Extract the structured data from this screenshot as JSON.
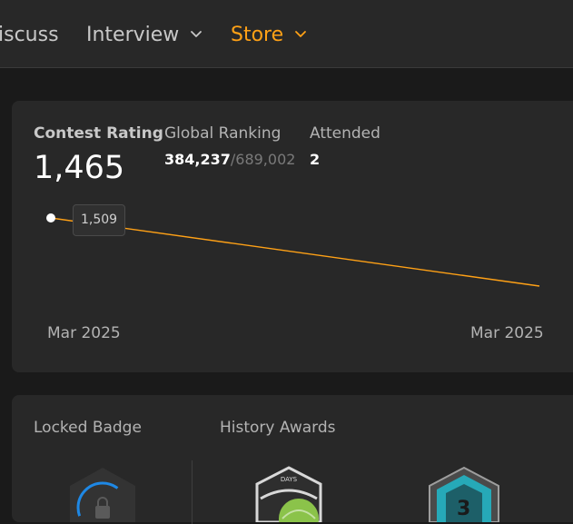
{
  "nav": {
    "items": [
      {
        "label": "iscuss"
      },
      {
        "label": "Interview"
      },
      {
        "label": "Store"
      }
    ],
    "accent": "#ffa116"
  },
  "rating": {
    "contest_rating_label": "Contest Rating",
    "contest_rating_value": "1,465",
    "global_ranking_label": "Global Ranking",
    "global_ranking_value": "384,237",
    "global_ranking_total": "/689,002",
    "attended_label": "Attended",
    "attended_value": "2",
    "tooltip_value": "1,509"
  },
  "chart_data": {
    "type": "line",
    "x": [
      "Mar 2025",
      "Mar 2025"
    ],
    "values": [
      1509,
      1465
    ],
    "x_tick_labels": [
      "Mar 2025",
      "Mar 2025"
    ],
    "line_color": "#ffa116",
    "grid": false
  },
  "badges": {
    "locked_badge_label": "Locked Badge",
    "history_awards_label": "History Awards",
    "award_days_label": "DAYS",
    "award_level_label": "3"
  }
}
